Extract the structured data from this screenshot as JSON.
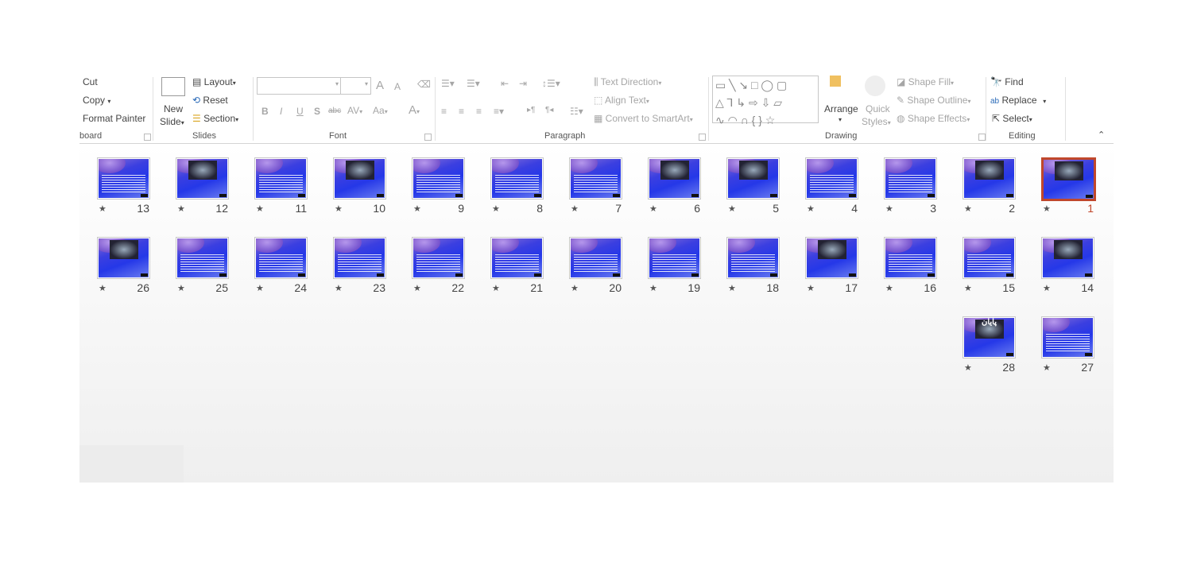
{
  "ribbon": {
    "clipboard": {
      "cut": "Cut",
      "copy": "Copy",
      "format_painter": "Format Painter",
      "label": "board"
    },
    "slides": {
      "new_slide_1": "New",
      "new_slide_2": "Slide",
      "layout": "Layout",
      "reset": "Reset",
      "section": "Section",
      "label": "Slides"
    },
    "font": {
      "bold": "B",
      "italic": "I",
      "underline": "U",
      "shadow": "S",
      "strike": "abc",
      "spacing": "AV",
      "case": "Aa",
      "color": "A",
      "grow": "A",
      "shrink": "A",
      "label": "Font"
    },
    "paragraph": {
      "text_direction": "Text Direction",
      "align_text": "Align Text",
      "convert_smartart": "Convert to SmartArt",
      "label": "Paragraph"
    },
    "drawing": {
      "arrange": "Arrange",
      "quick_styles_1": "Quick",
      "quick_styles_2": "Styles",
      "shape_fill": "Shape Fill",
      "shape_outline": "Shape Outline",
      "shape_effects": "Shape Effects",
      "label": "Drawing"
    },
    "editing": {
      "find": "Find",
      "replace": "Replace",
      "select": "Select",
      "label": "Editing"
    }
  },
  "accent": "#c0472b",
  "selected_slide": 1,
  "slides": [
    {
      "n": "1",
      "pic": true
    },
    {
      "n": "2",
      "pic": true
    },
    {
      "n": "3"
    },
    {
      "n": "4"
    },
    {
      "n": "5",
      "pic": true
    },
    {
      "n": "6",
      "pic": true
    },
    {
      "n": "7"
    },
    {
      "n": "8"
    },
    {
      "n": "9"
    },
    {
      "n": "10",
      "pic": true
    },
    {
      "n": "11"
    },
    {
      "n": "12",
      "pic": true
    },
    {
      "n": "13"
    },
    {
      "n": "14",
      "pic": true
    },
    {
      "n": "15"
    },
    {
      "n": "16"
    },
    {
      "n": "17",
      "pic": true
    },
    {
      "n": "18"
    },
    {
      "n": "19"
    },
    {
      "n": "20"
    },
    {
      "n": "21"
    },
    {
      "n": "22"
    },
    {
      "n": "23"
    },
    {
      "n": "24"
    },
    {
      "n": "25"
    },
    {
      "n": "26",
      "pic": true
    },
    {
      "n": "27"
    },
    {
      "n": "28",
      "pic": true,
      "title": "پایان"
    }
  ]
}
